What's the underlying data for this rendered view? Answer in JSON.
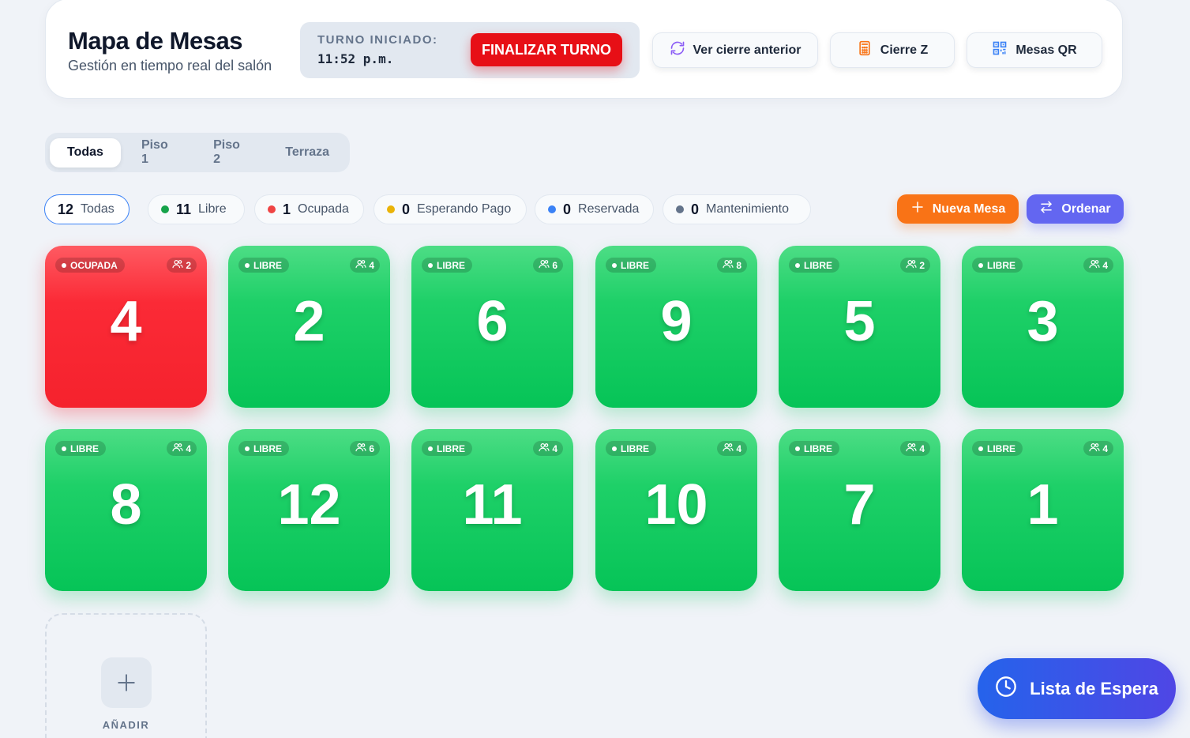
{
  "header": {
    "title": "Mapa de Mesas",
    "subtitle": "Gestión en tiempo real del salón",
    "shift_label": "TURNO INICIADO:",
    "shift_time": "11:52 p.m.",
    "finalize_label": "FINALIZAR TURNO",
    "buttons": [
      {
        "label": "Ver cierre anterior",
        "icon": "refresh-icon"
      },
      {
        "label": "Cierre Z",
        "icon": "calculator-icon"
      },
      {
        "label": "Mesas QR",
        "icon": "qr-code-icon"
      }
    ]
  },
  "floor_tabs": [
    "Todas",
    "Piso 1",
    "Piso 2",
    "Terraza"
  ],
  "active_floor_tab": "Todas",
  "status_filters": [
    {
      "count": "12",
      "label": "Todas",
      "color": null
    },
    {
      "count": "11",
      "label": "Libre",
      "color": "#16a34a"
    },
    {
      "count": "1",
      "label": "Ocupada",
      "color": "#ef4444"
    },
    {
      "count": "0",
      "label": "Esperando Pago",
      "color": "#eab308"
    },
    {
      "count": "0",
      "label": "Reservada",
      "color": "#3b82f6"
    },
    {
      "count": "0",
      "label": "Mantenimiento",
      "color": "#64748b"
    }
  ],
  "actions": {
    "new_table": "Nueva Mesa",
    "sort": "Ordenar"
  },
  "tables": [
    {
      "number": "4",
      "status": "OCUPADA",
      "capacity": "2"
    },
    {
      "number": "2",
      "status": "LIBRE",
      "capacity": "4"
    },
    {
      "number": "6",
      "status": "LIBRE",
      "capacity": "6"
    },
    {
      "number": "9",
      "status": "LIBRE",
      "capacity": "8"
    },
    {
      "number": "5",
      "status": "LIBRE",
      "capacity": "2"
    },
    {
      "number": "3",
      "status": "LIBRE",
      "capacity": "4"
    },
    {
      "number": "8",
      "status": "LIBRE",
      "capacity": "4"
    },
    {
      "number": "12",
      "status": "LIBRE",
      "capacity": "6"
    },
    {
      "number": "11",
      "status": "LIBRE",
      "capacity": "4"
    },
    {
      "number": "10",
      "status": "LIBRE",
      "capacity": "4"
    },
    {
      "number": "7",
      "status": "LIBRE",
      "capacity": "4"
    },
    {
      "number": "1",
      "status": "LIBRE",
      "capacity": "4"
    }
  ],
  "add_label": "AÑADIR",
  "waitlist_label": "Lista de Espera",
  "colors": {
    "libre": "#06c457",
    "ocupada": "#f5222d",
    "finalize": "#e70f16",
    "new_table": "#f97316",
    "sort": "#6366f1",
    "waitlist": "#2563eb"
  }
}
